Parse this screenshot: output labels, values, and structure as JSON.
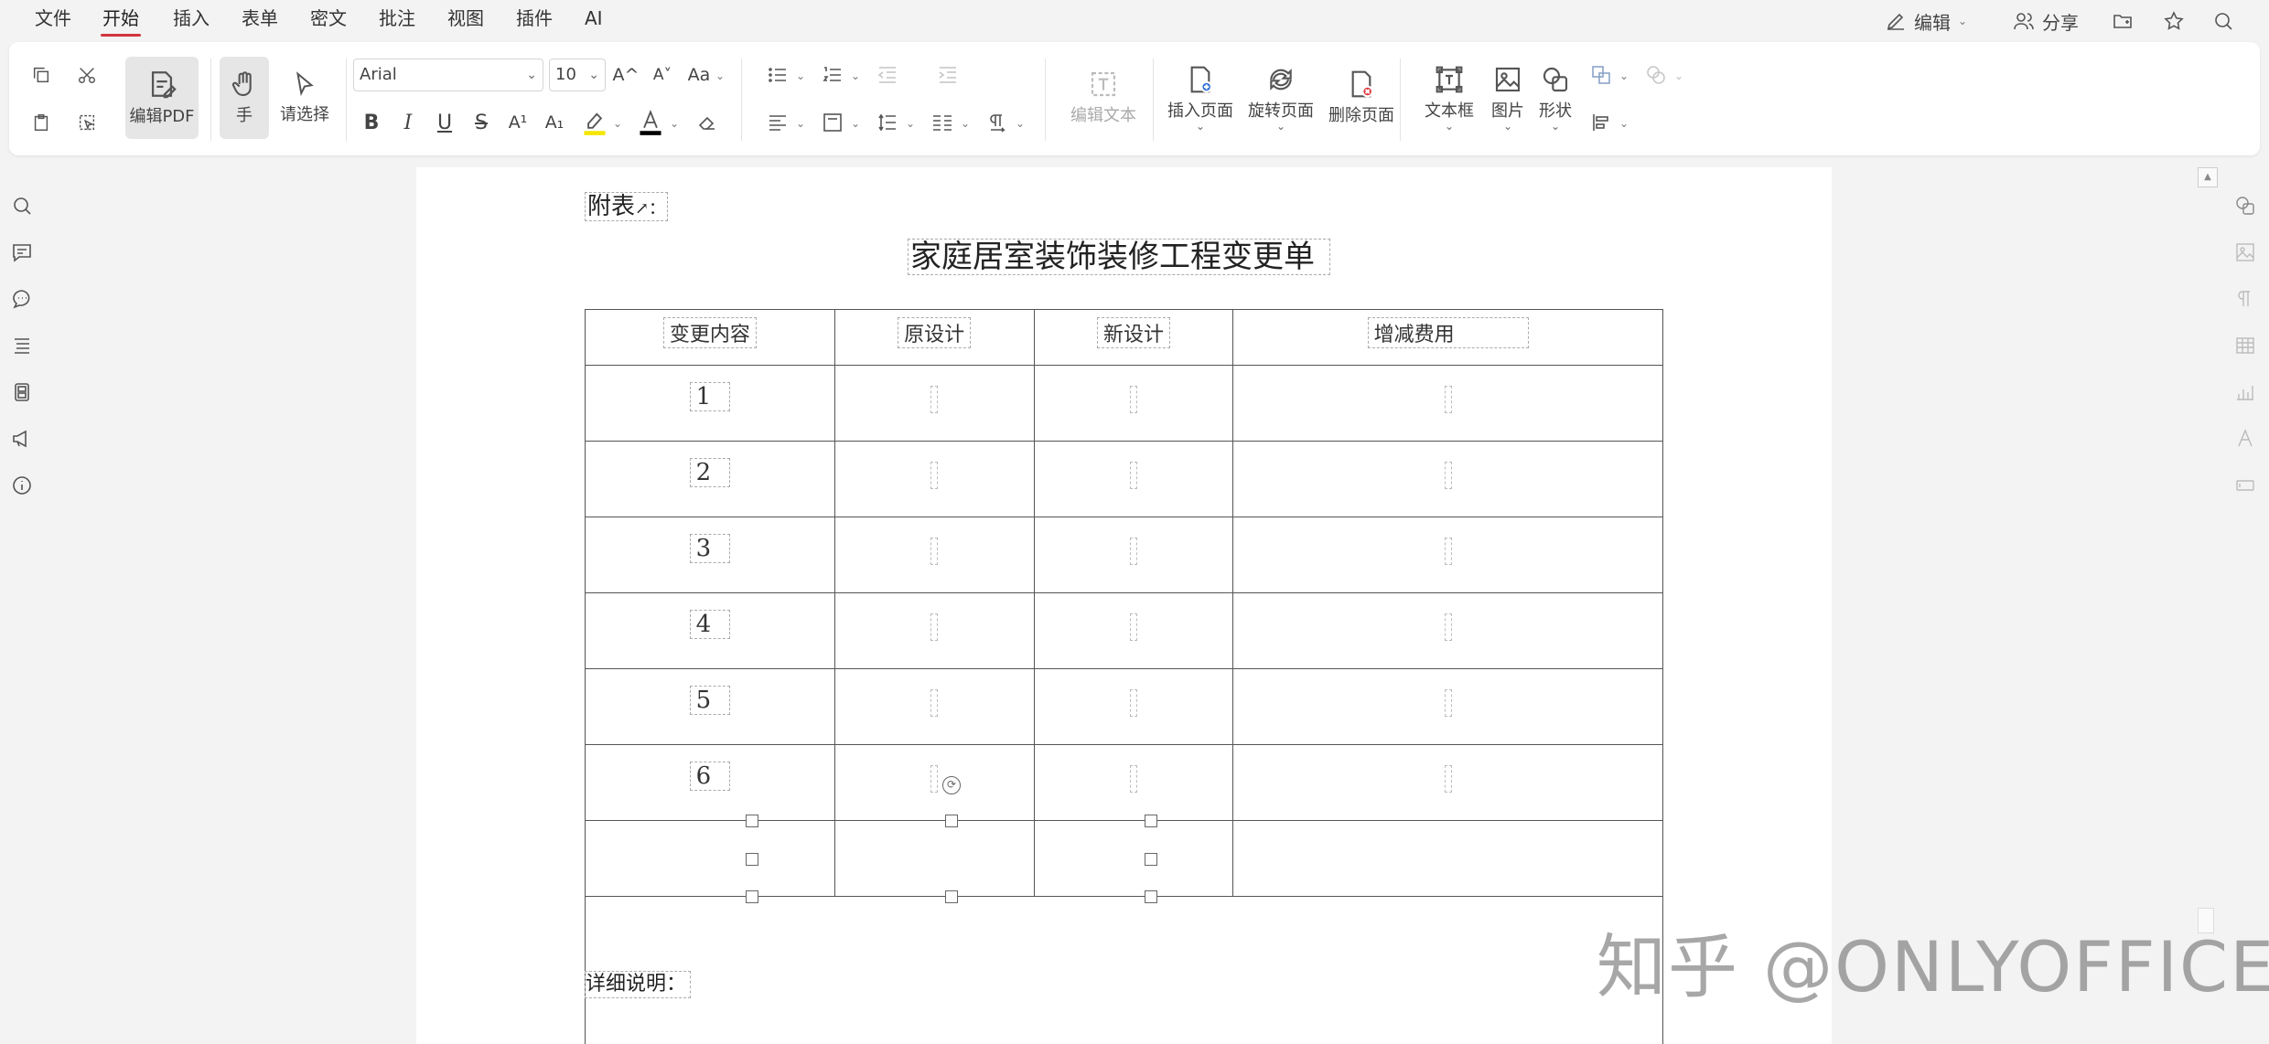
{
  "menu": {
    "items": [
      "文件",
      "开始",
      "插入",
      "表单",
      "密文",
      "批注",
      "视图",
      "插件",
      "AI"
    ],
    "active": "开始"
  },
  "top_right": {
    "edit_label": "编辑",
    "share_label": "分享"
  },
  "toolbar": {
    "edit_pdf": "编辑PDF",
    "hand": "手",
    "select": "请选择",
    "font_name": "Arial",
    "font_size": "10",
    "edit_text": "编辑文本",
    "insert_page": "插入页面",
    "rotate_page": "旋转页面",
    "delete_page": "删除页面",
    "text_box": "文本框",
    "image": "图片",
    "shape": "形状",
    "bold": "B",
    "italic": "I",
    "underline": "U",
    "strike": "S",
    "superscript": "A¹",
    "subscript": "A₁",
    "grow_font": "A^",
    "shrink_font": "A˅",
    "change_case": "Aa",
    "highlight_color": "#f5e600",
    "font_color": "#000000"
  },
  "document": {
    "appendix_label": "附表",
    "appendix_mark": "↗：",
    "title": "家庭居室装饰装修工程变更单",
    "table": {
      "headers": [
        "变更内容",
        "原设计",
        "新设计",
        "增减费用"
      ],
      "rows": [
        "1",
        "2",
        "3",
        "4",
        "5",
        "6"
      ]
    },
    "details_label": "详细说明："
  },
  "watermark": "知乎 @ONLYOFFICE",
  "colors": {
    "accent": "#d2343b",
    "delete_badge": "#e0383e",
    "insert_badge": "#2f6fd6"
  }
}
